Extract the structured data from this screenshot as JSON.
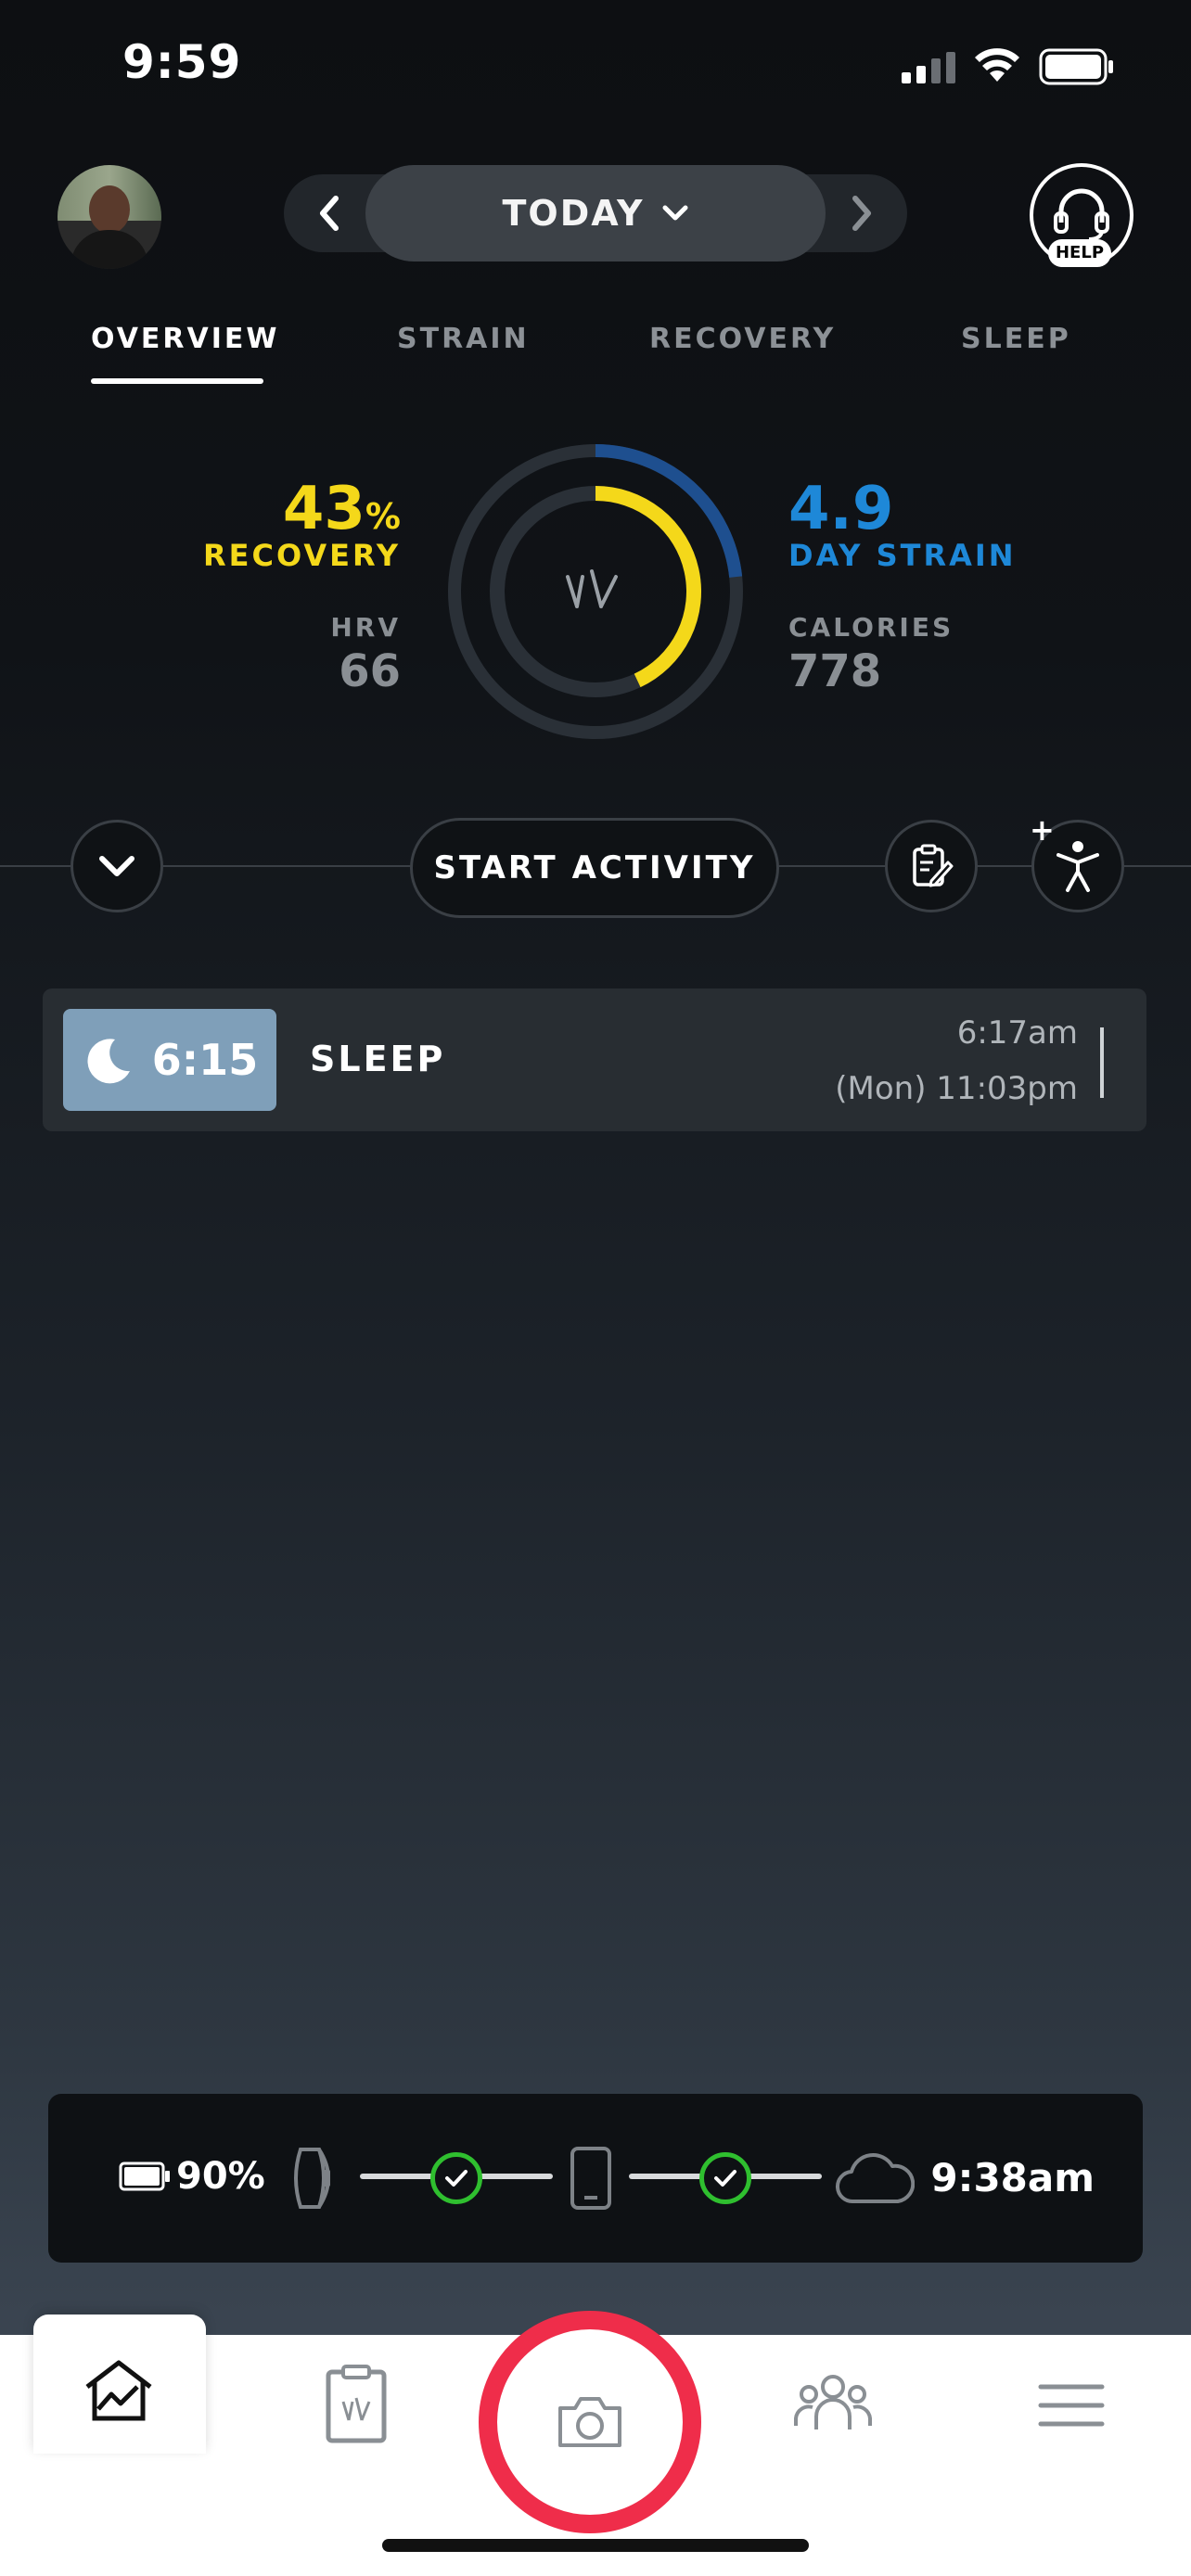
{
  "status_bar": {
    "time": "9:59"
  },
  "header": {
    "date_label": "TODAY",
    "help_label": "HELP"
  },
  "tabs": [
    {
      "label": "OVERVIEW",
      "active": true
    },
    {
      "label": "STRAIN",
      "active": false
    },
    {
      "label": "RECOVERY",
      "active": false
    },
    {
      "label": "SLEEP",
      "active": false
    }
  ],
  "overview": {
    "recovery_value": "43",
    "recovery_unit": "%",
    "recovery_label": "RECOVERY",
    "recovery_percent": 43,
    "hrv_label": "HRV",
    "hrv_value": "66",
    "strain_value": "4.9",
    "strain_label": "DAY STRAIN",
    "strain_max": 21,
    "calories_label": "CALORIES",
    "calories_value": "778",
    "colors": {
      "recovery": "#f4d81a",
      "strain": "#1e88d8",
      "muted": "#8a8f94"
    }
  },
  "actions": {
    "start_activity_label": "START ACTIVITY"
  },
  "activities": [
    {
      "type": "SLEEP",
      "duration": "6:15",
      "end_time": "6:17am",
      "start_time": "(Mon) 11:03pm",
      "icon": "moon-icon"
    }
  ],
  "sync": {
    "battery_percent": "90%",
    "last_sync_time": "9:38am"
  },
  "bottom_nav": [
    {
      "name": "home",
      "icon": "home-chart-icon",
      "active": true
    },
    {
      "name": "journal",
      "icon": "clipboard-icon",
      "active": false
    },
    {
      "name": "camera",
      "icon": "camera-icon",
      "active": false
    },
    {
      "name": "community",
      "icon": "people-icon",
      "active": false
    },
    {
      "name": "menu",
      "icon": "hamburger-icon",
      "active": false
    }
  ]
}
